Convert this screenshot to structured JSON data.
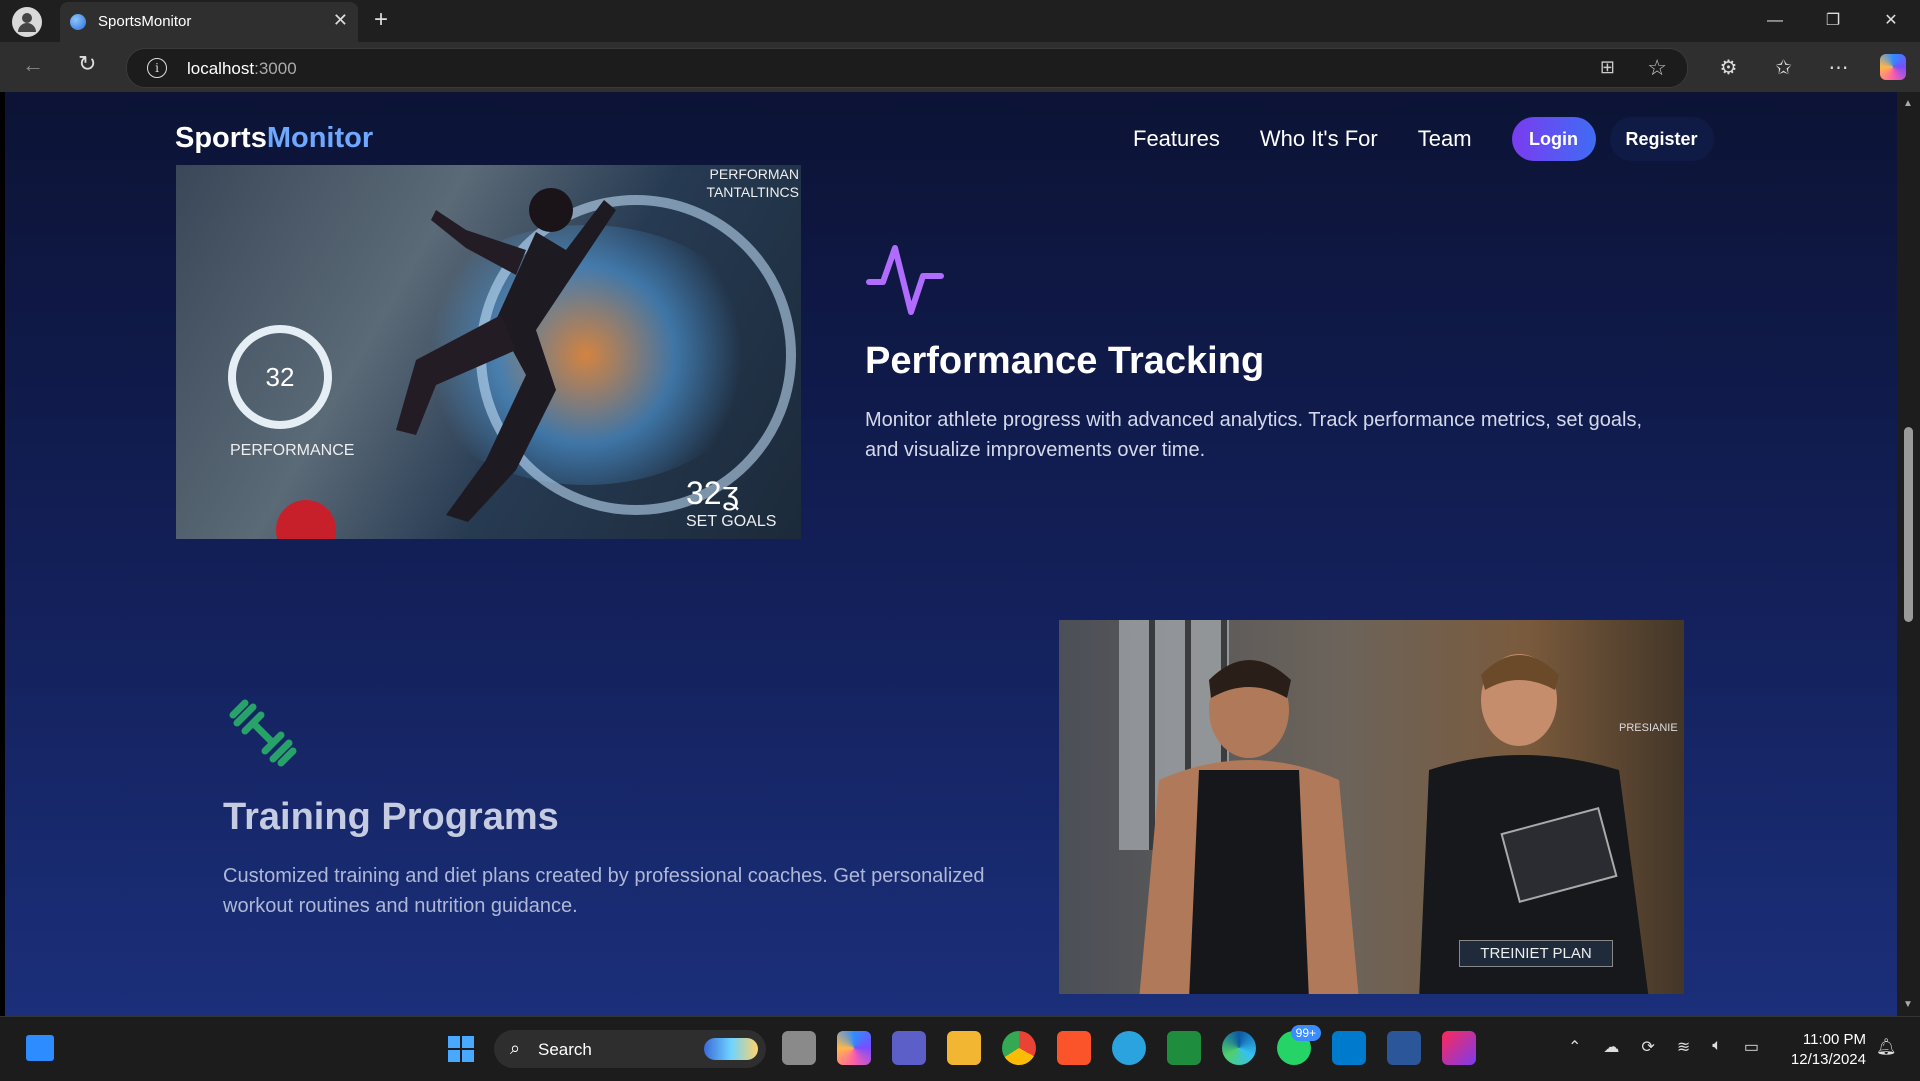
{
  "browser": {
    "tab_title": "SportsMonitor",
    "tab_close": "✕",
    "new_tab": "+",
    "url_host": "localhost",
    "url_port": ":3000",
    "window_controls": [
      "—",
      "❐",
      "✕"
    ],
    "toolbar_icons": [
      "extensions-icon",
      "favorites-icon",
      "more-icon",
      "copilot-icon"
    ]
  },
  "site": {
    "logo_part1": "Sports",
    "logo_part2": "Monitor",
    "nav": {
      "features": "Features",
      "who": "Who It's For",
      "team": "Team",
      "login": "Login",
      "register": "Register"
    }
  },
  "features": [
    {
      "title": "Performance Tracking",
      "description": "Monitor athlete progress with advanced analytics. Track performance metrics, set goals, and visualize improvements over time.",
      "icon": "pulse-icon",
      "image_text": {
        "top_caption": "PERFORMAN\nTANTALTINCS",
        "gauge_value": "32",
        "gauge_label": "PERFORMANCE",
        "stat": "32ʓ",
        "goal": "SET GOALS"
      }
    },
    {
      "title": "Training Programs",
      "description": "Customized training and diet plans created by professional coaches. Get personalized workout routines and nutrition guidance.",
      "icon": "dumbbell-icon",
      "image_text": {
        "plan": "TREINIET PLAN",
        "side_label": "PRESIANIE"
      }
    }
  ],
  "taskbar": {
    "search": "Search",
    "whatsapp_badge": "99+",
    "time": "11:00 PM",
    "date": "12/13/2024"
  },
  "colors": {
    "accent_purple": "#7a3cf0",
    "accent_blue": "#6fa8ff",
    "icon_purple": "#b06cff",
    "icon_green": "#27a36a"
  }
}
